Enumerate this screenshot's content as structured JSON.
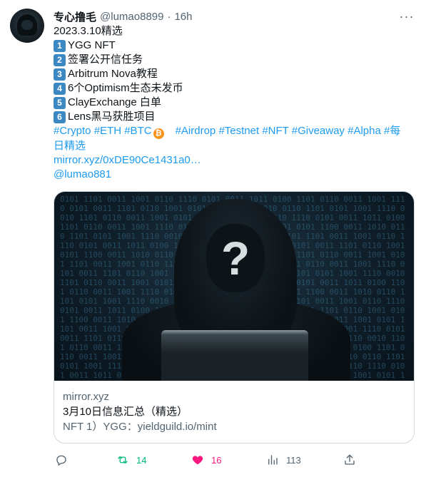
{
  "author": {
    "name": "专心撸毛",
    "handle": "@lumao8899",
    "separator": "·",
    "time": "16h"
  },
  "tweet": {
    "date_line": "2023.3.10精选",
    "items": [
      {
        "num": "1",
        "text": "YGG NFT"
      },
      {
        "num": "2",
        "text": "签署公开信任务"
      },
      {
        "num": "3",
        "text": "Arbitrum Nova教程"
      },
      {
        "num": "4",
        "text": "6个Optimism生态未发币"
      },
      {
        "num": "5",
        "text": "ClayExchange 白单"
      },
      {
        "num": "6",
        "text": "Lens黑马获胜项目"
      }
    ],
    "hashtags_line1": [
      "#Crypto",
      "#ETH",
      "#BTC"
    ],
    "btc_symbol": "₿",
    "hashtags_line1b": [
      "#Airdrop",
      "#Testnet",
      "#NFT",
      "#Giveaway",
      "#Alpha",
      "#每"
    ],
    "hashtags_line2": "日精选",
    "link": "mirror.xyz/0xDE90Ce1431a0…",
    "mention": "@lumao881"
  },
  "card": {
    "domain": "mirror.xyz",
    "title": "3月10日信息汇总（精选）",
    "description": "NFT 1）YGG：yieldguild.io/mint",
    "image_glyph": "?"
  },
  "actions": {
    "replies": "",
    "retweets": "14",
    "likes": "16",
    "views": "113"
  },
  "colors": {
    "link": "#1d9bf0",
    "retweet": "#00ba7c",
    "like": "#f91880",
    "muted": "#536471",
    "keycap": "#3b88c3",
    "btc": "#f7931a"
  },
  "icons": {
    "more": "more-dots-icon",
    "reply": "reply-icon",
    "retweet": "retweet-icon",
    "like": "heart-icon",
    "views": "views-chart-icon",
    "share": "share-icon"
  }
}
